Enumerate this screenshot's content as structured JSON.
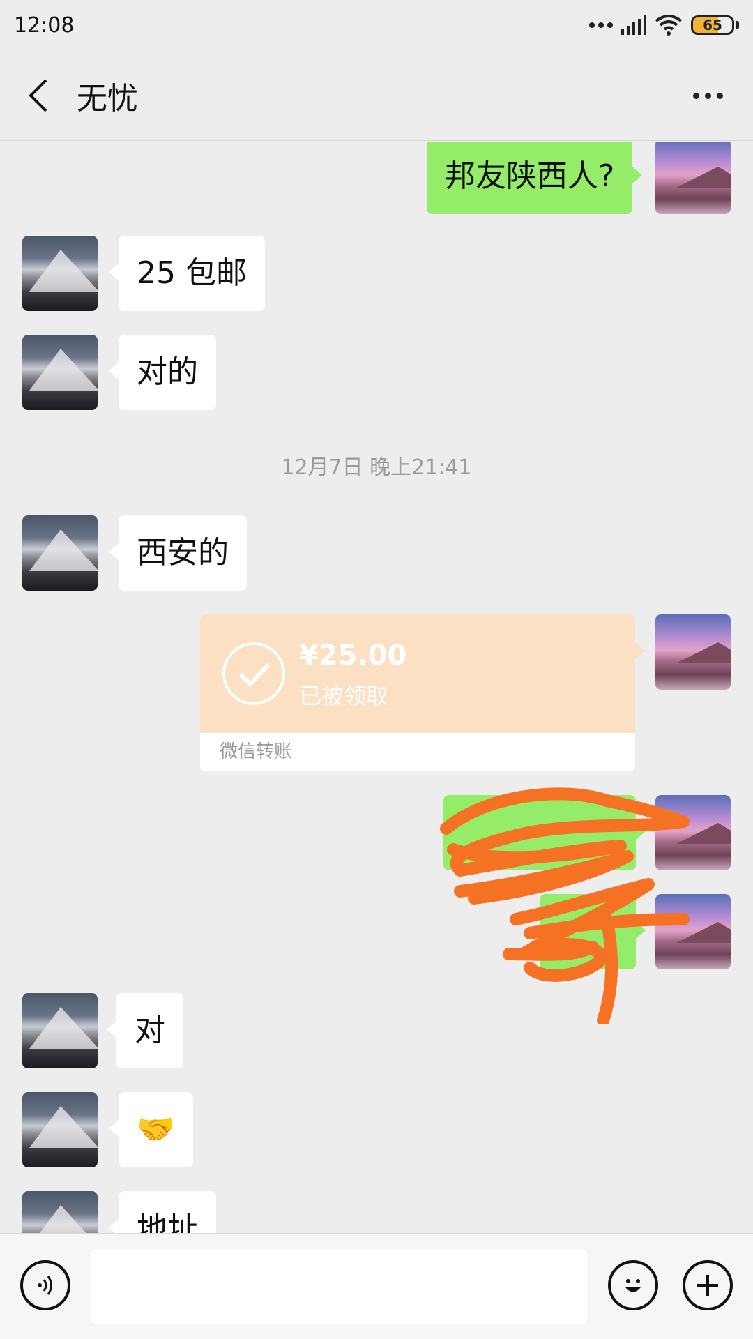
{
  "status_bar": {
    "time": "12:08",
    "battery": "65",
    "battery_level": 0.65
  },
  "header": {
    "title": "无忧"
  },
  "messages": {
    "m1": "邦友陕西人?",
    "m2": "25 包邮",
    "m3": "对的",
    "timestamp": "12月7日 晚上21:41",
    "m4": "西安的",
    "transfer": {
      "amount": "¥25.00",
      "status": "已被领取",
      "label": "微信转账"
    },
    "m7": "对",
    "m8": "🤝",
    "m9": "地址"
  },
  "colors": {
    "outgoing_bubble": "#95ec69",
    "incoming_bubble": "#ffffff",
    "transfer": "#fbe0c3",
    "scribble": "#f57224"
  }
}
